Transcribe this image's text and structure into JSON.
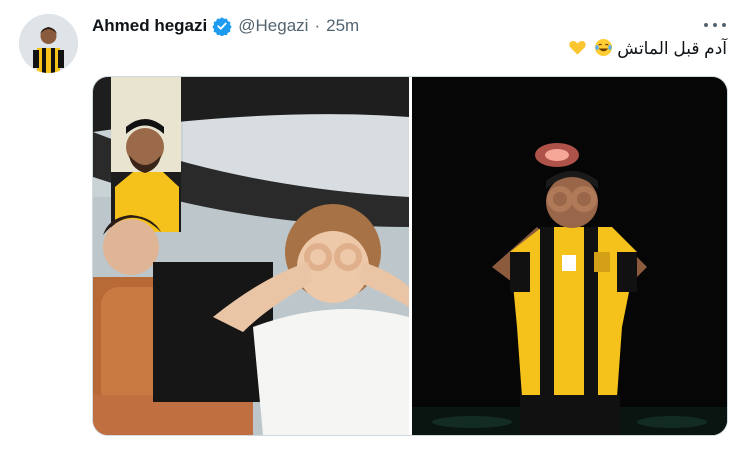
{
  "tweet": {
    "author_name": "Ahmed hegazi",
    "handle": "@Hegazi",
    "separator": "·",
    "time": "25m",
    "text": "آدم قبل الماتش",
    "emojis": [
      "face-with-tears-of-joy-icon",
      "yellow-heart-icon"
    ],
    "verified": true
  },
  "colors": {
    "verified": "#1d9bf0",
    "secondary_text": "#536471",
    "primary_text": "#0f1419",
    "kit_yellow": "#f4c21b",
    "kit_black": "#111111"
  },
  "media": {
    "photos": [
      {
        "subject": "children in car with video-call inset"
      },
      {
        "subject": "player in black and yellow kit making goggles gesture"
      }
    ]
  }
}
